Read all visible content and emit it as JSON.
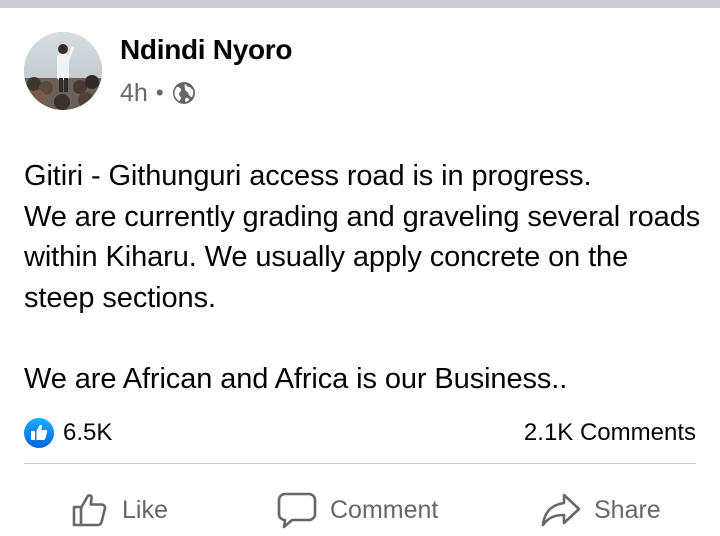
{
  "post": {
    "author": "Ndindi Nyoro",
    "time": "4h",
    "separator": "•",
    "audience_icon": "globe-icon",
    "text": "Gitiri - Githunguri access road is in progress.\nWe are currently grading and graveling several roads within Kiharu. We usually apply concrete on the steep sections.\n\nWe are African and Africa is our Business..",
    "reactions_count": "6.5K",
    "comments_count": "2.1K Comments"
  },
  "actions": {
    "like_label": "Like",
    "comment_label": "Comment",
    "share_label": "Share"
  },
  "colors": {
    "accent_blue": "#1877f2",
    "secondary_text": "#65676b",
    "divider": "#ced0d4",
    "top_strip": "#c9ccd1"
  }
}
